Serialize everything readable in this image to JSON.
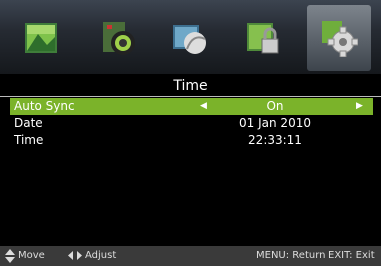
{
  "tabs": [
    {
      "name": "picture-tab-icon"
    },
    {
      "name": "sound-tab-icon"
    },
    {
      "name": "channel-tab-icon"
    },
    {
      "name": "lock-tab-icon"
    },
    {
      "name": "setup-tab-icon",
      "selected": true
    }
  ],
  "menu": {
    "title": "Time",
    "rows": [
      {
        "label": "Auto Sync",
        "value": "On"
      },
      {
        "label": "Date",
        "value": "01 Jan 2010"
      },
      {
        "label": "Time",
        "value": "22:33:11"
      }
    ]
  },
  "footer": {
    "move": "Move",
    "adjust": "Adjust",
    "menu_return": "MENU: Return",
    "exit": "EXIT: Exit"
  },
  "colors": {
    "highlight": "#7bb32a",
    "footer_bg": "#3a3a3a"
  }
}
